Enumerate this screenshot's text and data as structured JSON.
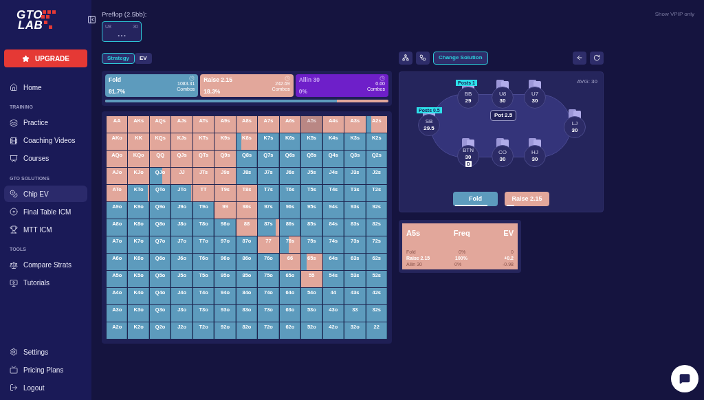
{
  "sidebar": {
    "logo": {
      "line1": "GTO",
      "line2": "LAB"
    },
    "upgrade": "UPGRADE",
    "sections": [
      {
        "items": [
          {
            "label": "Home",
            "selected": false
          }
        ]
      },
      {
        "heading": "TRAINING",
        "items": [
          {
            "label": "Practice",
            "selected": false
          },
          {
            "label": "Coaching Videos",
            "selected": false
          },
          {
            "label": "Courses",
            "selected": false
          }
        ]
      },
      {
        "heading": "GTO SOLUTIONS",
        "items": [
          {
            "label": "Chip EV",
            "selected": true
          },
          {
            "label": "Final Table ICM",
            "selected": false
          },
          {
            "label": "MTT ICM",
            "selected": false
          }
        ]
      },
      {
        "heading": "TOOLS",
        "items": [
          {
            "label": "Compare Strats",
            "selected": false
          },
          {
            "label": "Tutorials",
            "selected": false
          }
        ]
      }
    ],
    "bottom_items": [
      {
        "label": "Settings",
        "selected": false
      },
      {
        "label": "Pricing Plans",
        "selected": false
      },
      {
        "label": "Logout",
        "selected": false
      }
    ]
  },
  "header": {
    "street": "Preflop (2.5bb):",
    "history": [
      {
        "position": "U8",
        "stack": "30",
        "dots": "• • •",
        "selected": true
      }
    ],
    "vpip_toggle": "Show VPIP only"
  },
  "view_tabs": [
    {
      "label": "Strategy",
      "selected": true
    },
    {
      "label": "EV",
      "selected": false
    }
  ],
  "actions": [
    {
      "kind": "fold",
      "name": "Fold",
      "percent": "81.7%",
      "combos": "1083.31",
      "combos_label": "Combos"
    },
    {
      "kind": "raise",
      "name": "Raise 2.15",
      "percent": "18.3%",
      "combos": "242.69",
      "combos_label": "Combos"
    },
    {
      "kind": "allin",
      "name": "Allin 30",
      "percent": "0%",
      "combos": "0.00",
      "combos_label": "Combos"
    }
  ],
  "frequency_bar": {
    "level": 0.817
  },
  "grid": [
    {
      "cells": [
        {
          "hand": "AA",
          "level": 1,
          "selected": false
        },
        {
          "hand": "AKs",
          "level": 1,
          "selected": false
        },
        {
          "hand": "AQs",
          "level": 1,
          "selected": false
        },
        {
          "hand": "AJs",
          "level": 1,
          "selected": false
        },
        {
          "hand": "ATs",
          "level": 1,
          "selected": false
        },
        {
          "hand": "A9s",
          "level": 1,
          "selected": false
        },
        {
          "hand": "A8s",
          "level": 1,
          "selected": false
        },
        {
          "hand": "A7s",
          "level": 1,
          "selected": false
        },
        {
          "hand": "A6s",
          "level": 1,
          "selected": false
        },
        {
          "hand": "A5s",
          "level": 1,
          "selected": true
        },
        {
          "hand": "A4s",
          "level": 1,
          "selected": false
        },
        {
          "hand": "A3s",
          "level": 1,
          "selected": false
        },
        {
          "hand": "A2s",
          "level": 0.75,
          "selected": false
        }
      ]
    },
    {
      "cells": [
        {
          "hand": "AKo",
          "level": 1,
          "selected": false
        },
        {
          "hand": "KK",
          "level": 1,
          "selected": false
        },
        {
          "hand": "KQs",
          "level": 1,
          "selected": false
        },
        {
          "hand": "KJs",
          "level": 1,
          "selected": false
        },
        {
          "hand": "KTs",
          "level": 1,
          "selected": false
        },
        {
          "hand": "K9s",
          "level": 1,
          "selected": false
        },
        {
          "hand": "K8s",
          "level": 0.75,
          "selected": false
        },
        {
          "hand": "K7s",
          "level": 0,
          "selected": false
        },
        {
          "hand": "K6s",
          "level": 0,
          "selected": false
        },
        {
          "hand": "K5s",
          "level": 0,
          "selected": false
        },
        {
          "hand": "K4s",
          "level": 0,
          "selected": false
        },
        {
          "hand": "K3s",
          "level": 0,
          "selected": false
        },
        {
          "hand": "K2s",
          "level": 0,
          "selected": false
        }
      ]
    },
    {
      "cells": [
        {
          "hand": "AQo",
          "level": 1,
          "selected": false
        },
        {
          "hand": "KQo",
          "level": 1,
          "selected": false
        },
        {
          "hand": "QQ",
          "level": 1,
          "selected": false
        },
        {
          "hand": "QJs",
          "level": 1,
          "selected": false
        },
        {
          "hand": "QTs",
          "level": 1,
          "selected": false
        },
        {
          "hand": "Q9s",
          "level": 1,
          "selected": false
        },
        {
          "hand": "Q8s",
          "level": 0,
          "selected": false
        },
        {
          "hand": "Q7s",
          "level": 0,
          "selected": false
        },
        {
          "hand": "Q6s",
          "level": 0,
          "selected": false
        },
        {
          "hand": "Q5s",
          "level": 0,
          "selected": false
        },
        {
          "hand": "Q4s",
          "level": 0,
          "selected": false
        },
        {
          "hand": "Q3s",
          "level": 0,
          "selected": false
        },
        {
          "hand": "Q2s",
          "level": 0,
          "selected": false
        }
      ]
    },
    {
      "cells": [
        {
          "hand": "AJo",
          "level": 1,
          "selected": false
        },
        {
          "hand": "KJo",
          "level": 1,
          "selected": false
        },
        {
          "hand": "QJo",
          "level": 0.4,
          "selected": false
        },
        {
          "hand": "JJ",
          "level": 1,
          "selected": false
        },
        {
          "hand": "JTs",
          "level": 1,
          "selected": false
        },
        {
          "hand": "J9s",
          "level": 1,
          "selected": false
        },
        {
          "hand": "J8s",
          "level": 0,
          "selected": false
        },
        {
          "hand": "J7s",
          "level": 0,
          "selected": false
        },
        {
          "hand": "J6s",
          "level": 0,
          "selected": false
        },
        {
          "hand": "J5s",
          "level": 0,
          "selected": false
        },
        {
          "hand": "J4s",
          "level": 0,
          "selected": false
        },
        {
          "hand": "J3s",
          "level": 0,
          "selected": false
        },
        {
          "hand": "J2s",
          "level": 0,
          "selected": false
        }
      ]
    },
    {
      "cells": [
        {
          "hand": "ATo",
          "level": 1,
          "selected": false
        },
        {
          "hand": "KTo",
          "level": 0.05,
          "selected": false
        },
        {
          "hand": "QTo",
          "level": 0,
          "selected": false
        },
        {
          "hand": "JTo",
          "level": 0.05,
          "selected": false
        },
        {
          "hand": "TT",
          "level": 1,
          "selected": false
        },
        {
          "hand": "T9s",
          "level": 1,
          "selected": false
        },
        {
          "hand": "T8s",
          "level": 1,
          "selected": false
        },
        {
          "hand": "T7s",
          "level": 0,
          "selected": false
        },
        {
          "hand": "T6s",
          "level": 0,
          "selected": false
        },
        {
          "hand": "T5s",
          "level": 0,
          "selected": false
        },
        {
          "hand": "T4s",
          "level": 0,
          "selected": false
        },
        {
          "hand": "T3s",
          "level": 0,
          "selected": false
        },
        {
          "hand": "T2s",
          "level": 0,
          "selected": false
        }
      ]
    },
    {
      "cells": [
        {
          "hand": "A9o",
          "level": 0,
          "selected": false
        },
        {
          "hand": "K9o",
          "level": 0,
          "selected": false
        },
        {
          "hand": "Q9o",
          "level": 0,
          "selected": false
        },
        {
          "hand": "J9o",
          "level": 0,
          "selected": false
        },
        {
          "hand": "T9o",
          "level": 0,
          "selected": false
        },
        {
          "hand": "99",
          "level": 1,
          "selected": false
        },
        {
          "hand": "98s",
          "level": 1,
          "selected": false
        },
        {
          "hand": "97s",
          "level": 0,
          "selected": false
        },
        {
          "hand": "96s",
          "level": 0,
          "selected": false
        },
        {
          "hand": "95s",
          "level": 0,
          "selected": false
        },
        {
          "hand": "94s",
          "level": 0,
          "selected": false
        },
        {
          "hand": "93s",
          "level": 0,
          "selected": false
        },
        {
          "hand": "92s",
          "level": 0,
          "selected": false
        }
      ]
    },
    {
      "cells": [
        {
          "hand": "A8o",
          "level": 0,
          "selected": false
        },
        {
          "hand": "K8o",
          "level": 0,
          "selected": false
        },
        {
          "hand": "Q8o",
          "level": 0,
          "selected": false
        },
        {
          "hand": "J8o",
          "level": 0,
          "selected": false
        },
        {
          "hand": "T8o",
          "level": 0,
          "selected": false
        },
        {
          "hand": "98o",
          "level": 0,
          "selected": false
        },
        {
          "hand": "88",
          "level": 1,
          "selected": false
        },
        {
          "hand": "87s",
          "level": 0.15,
          "selected": false
        },
        {
          "hand": "86s",
          "level": 0,
          "selected": false
        },
        {
          "hand": "85s",
          "level": 0,
          "selected": false
        },
        {
          "hand": "84s",
          "level": 0,
          "selected": false
        },
        {
          "hand": "83s",
          "level": 0,
          "selected": false
        },
        {
          "hand": "82s",
          "level": 0,
          "selected": false
        }
      ]
    },
    {
      "cells": [
        {
          "hand": "A7o",
          "level": 0,
          "selected": false
        },
        {
          "hand": "K7o",
          "level": 0,
          "selected": false
        },
        {
          "hand": "Q7o",
          "level": 0,
          "selected": false
        },
        {
          "hand": "J7o",
          "level": 0,
          "selected": false
        },
        {
          "hand": "T7o",
          "level": 0,
          "selected": false
        },
        {
          "hand": "97o",
          "level": 0,
          "selected": false
        },
        {
          "hand": "87o",
          "level": 0,
          "selected": false
        },
        {
          "hand": "77",
          "level": 1,
          "selected": false
        },
        {
          "hand": "76s",
          "level": 0.55,
          "selected": false
        },
        {
          "hand": "75s",
          "level": 0,
          "selected": false
        },
        {
          "hand": "74s",
          "level": 0,
          "selected": false
        },
        {
          "hand": "73s",
          "level": 0,
          "selected": false
        },
        {
          "hand": "72s",
          "level": 0,
          "selected": false
        }
      ]
    },
    {
      "cells": [
        {
          "hand": "A6o",
          "level": 0,
          "selected": false
        },
        {
          "hand": "K6o",
          "level": 0,
          "selected": false
        },
        {
          "hand": "Q6o",
          "level": 0,
          "selected": false
        },
        {
          "hand": "J6o",
          "level": 0,
          "selected": false
        },
        {
          "hand": "T6o",
          "level": 0,
          "selected": false
        },
        {
          "hand": "96o",
          "level": 0,
          "selected": false
        },
        {
          "hand": "86o",
          "level": 0,
          "selected": false
        },
        {
          "hand": "76o",
          "level": 0,
          "selected": false
        },
        {
          "hand": "66",
          "level": 1,
          "selected": false
        },
        {
          "hand": "65s",
          "level": 0.75,
          "selected": false
        },
        {
          "hand": "64s",
          "level": 0,
          "selected": false
        },
        {
          "hand": "63s",
          "level": 0,
          "selected": false
        },
        {
          "hand": "62s",
          "level": 0,
          "selected": false
        }
      ]
    },
    {
      "cells": [
        {
          "hand": "A5o",
          "level": 0,
          "selected": false
        },
        {
          "hand": "K5o",
          "level": 0,
          "selected": false
        },
        {
          "hand": "Q5o",
          "level": 0,
          "selected": false
        },
        {
          "hand": "J5o",
          "level": 0,
          "selected": false
        },
        {
          "hand": "T5o",
          "level": 0,
          "selected": false
        },
        {
          "hand": "95o",
          "level": 0,
          "selected": false
        },
        {
          "hand": "85o",
          "level": 0,
          "selected": false
        },
        {
          "hand": "75o",
          "level": 0,
          "selected": false
        },
        {
          "hand": "65o",
          "level": 0,
          "selected": false
        },
        {
          "hand": "55",
          "level": 1,
          "selected": false
        },
        {
          "hand": "54s",
          "level": 0,
          "selected": false
        },
        {
          "hand": "53s",
          "level": 0,
          "selected": false
        },
        {
          "hand": "52s",
          "level": 0,
          "selected": false
        }
      ]
    },
    {
      "cells": [
        {
          "hand": "A4o",
          "level": 0,
          "selected": false
        },
        {
          "hand": "K4o",
          "level": 0,
          "selected": false
        },
        {
          "hand": "Q4o",
          "level": 0,
          "selected": false
        },
        {
          "hand": "J4o",
          "level": 0,
          "selected": false
        },
        {
          "hand": "T4o",
          "level": 0,
          "selected": false
        },
        {
          "hand": "94o",
          "level": 0,
          "selected": false
        },
        {
          "hand": "84o",
          "level": 0,
          "selected": false
        },
        {
          "hand": "74o",
          "level": 0,
          "selected": false
        },
        {
          "hand": "64o",
          "level": 0,
          "selected": false
        },
        {
          "hand": "54o",
          "level": 0,
          "selected": false
        },
        {
          "hand": "44",
          "level": 0,
          "selected": false
        },
        {
          "hand": "43s",
          "level": 0,
          "selected": false
        },
        {
          "hand": "42s",
          "level": 0,
          "selected": false
        }
      ]
    },
    {
      "cells": [
        {
          "hand": "A3o",
          "level": 0,
          "selected": false
        },
        {
          "hand": "K3o",
          "level": 0,
          "selected": false
        },
        {
          "hand": "Q3o",
          "level": 0,
          "selected": false
        },
        {
          "hand": "J3o",
          "level": 0,
          "selected": false
        },
        {
          "hand": "T3o",
          "level": 0,
          "selected": false
        },
        {
          "hand": "93o",
          "level": 0,
          "selected": false
        },
        {
          "hand": "83o",
          "level": 0,
          "selected": false
        },
        {
          "hand": "73o",
          "level": 0,
          "selected": false
        },
        {
          "hand": "63o",
          "level": 0,
          "selected": false
        },
        {
          "hand": "53o",
          "level": 0,
          "selected": false
        },
        {
          "hand": "43o",
          "level": 0,
          "selected": false
        },
        {
          "hand": "33",
          "level": 0,
          "selected": false
        },
        {
          "hand": "32s",
          "level": 0,
          "selected": false
        }
      ]
    },
    {
      "cells": [
        {
          "hand": "A2o",
          "level": 0,
          "selected": false
        },
        {
          "hand": "K2o",
          "level": 0,
          "selected": false
        },
        {
          "hand": "Q2o",
          "level": 0,
          "selected": false
        },
        {
          "hand": "J2o",
          "level": 0,
          "selected": false
        },
        {
          "hand": "T2o",
          "level": 0,
          "selected": false
        },
        {
          "hand": "92o",
          "level": 0,
          "selected": false
        },
        {
          "hand": "82o",
          "level": 0,
          "selected": false
        },
        {
          "hand": "72o",
          "level": 0,
          "selected": false
        },
        {
          "hand": "62o",
          "level": 0,
          "selected": false
        },
        {
          "hand": "52o",
          "level": 0,
          "selected": false
        },
        {
          "hand": "42o",
          "level": 0,
          "selected": false
        },
        {
          "hand": "32o",
          "level": 0,
          "selected": false
        },
        {
          "hand": "22",
          "level": 0,
          "selected": false
        }
      ]
    }
  ],
  "toolbar": {
    "change_solution": "Change Solution"
  },
  "table": {
    "average": "AVG: 30",
    "pot": "Pot 2.5",
    "seats": [
      {
        "position": "BB",
        "stack": "29",
        "post": "Posts 1",
        "dealer": false
      },
      {
        "position": "U8",
        "stack": "30",
        "dealer": false
      },
      {
        "position": "U7",
        "stack": "30",
        "dealer": false
      },
      {
        "position": "SB",
        "stack": "29.5",
        "post": "Posts 0.5",
        "dealer": false
      },
      {
        "position": "LJ",
        "stack": "30",
        "dealer": false
      },
      {
        "position": "BTN",
        "stack": "30",
        "dealer": true,
        "dealer_label": "D"
      },
      {
        "position": "CO",
        "stack": "30",
        "dealer": false
      },
      {
        "position": "HJ",
        "stack": "30",
        "dealer": false
      }
    ],
    "buttons": [
      {
        "kind": "fold",
        "label": "Fold",
        "level": 0.8
      },
      {
        "kind": "raise",
        "label": "Raise 2.15",
        "level": 0.18
      }
    ]
  },
  "hand_detail": {
    "columns": [
      "A5s",
      "Freq",
      "EV"
    ],
    "rows": [
      {
        "action": "Fold",
        "freq": "0%",
        "ev": "0",
        "emphasized": false
      },
      {
        "action": "Raise 2.15",
        "freq": "100%",
        "ev": "+0.2",
        "emphasized": true
      },
      {
        "action": "Allin 30",
        "freq": "0%",
        "ev": "-0.98",
        "emphasized": false
      }
    ]
  }
}
